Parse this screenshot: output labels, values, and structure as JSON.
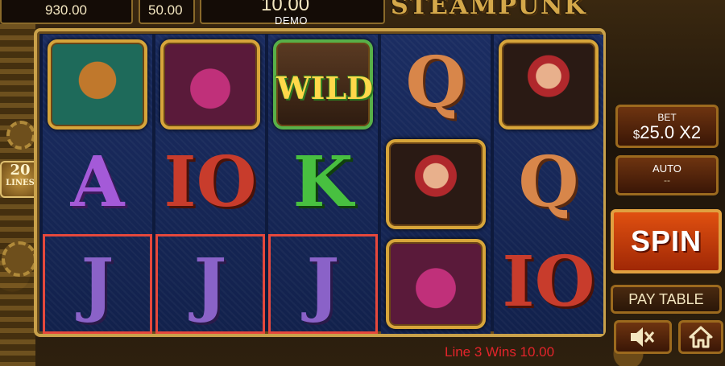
{
  "topbar": {
    "balance": "930.00",
    "lines_bet": "50.00",
    "win": "10.00",
    "mode": "DEMO",
    "logo_text": "STEAMPUNK"
  },
  "lines_badge": {
    "number": "20",
    "label": "LINES"
  },
  "reels": [
    [
      {
        "type": "helmet"
      },
      {
        "type": "letter",
        "char": "A",
        "color": "purple"
      },
      {
        "type": "letter",
        "char": "J",
        "color": "violet",
        "win": true
      }
    ],
    [
      {
        "type": "camera"
      },
      {
        "type": "letter",
        "char": "IO",
        "color": "red"
      },
      {
        "type": "letter",
        "char": "J",
        "color": "violet",
        "win": true
      }
    ],
    [
      {
        "type": "wild",
        "label": "WILD"
      },
      {
        "type": "letter",
        "char": "K",
        "color": "green"
      },
      {
        "type": "letter",
        "char": "J",
        "color": "violet",
        "win": true
      }
    ],
    [
      {
        "type": "letter",
        "char": "Q",
        "color": "copper"
      },
      {
        "type": "lady"
      },
      {
        "type": "camera"
      }
    ],
    [
      {
        "type": "lady",
        "tall": false
      },
      {
        "type": "letter",
        "char": "Q",
        "color": "copper"
      },
      {
        "type": "letter",
        "char": "IO",
        "color": "red"
      }
    ]
  ],
  "controls": {
    "bet_label": "BET",
    "bet_currency": "$",
    "bet_value": "25.0 X2",
    "auto_label": "AUTO",
    "auto_value": "--",
    "spin_label": "SPIN",
    "paytable_label": "PAY TABLE",
    "sound_icon": "speaker-muted-icon",
    "home_icon": "home-icon"
  },
  "status": {
    "win_message": "Line 3 Wins 10.00"
  },
  "colors": {
    "frame_gold": "#c9a14a",
    "reel_blue": "#1b2d62",
    "win_highlight": "#e5483c",
    "spin_orange": "#e05010"
  }
}
